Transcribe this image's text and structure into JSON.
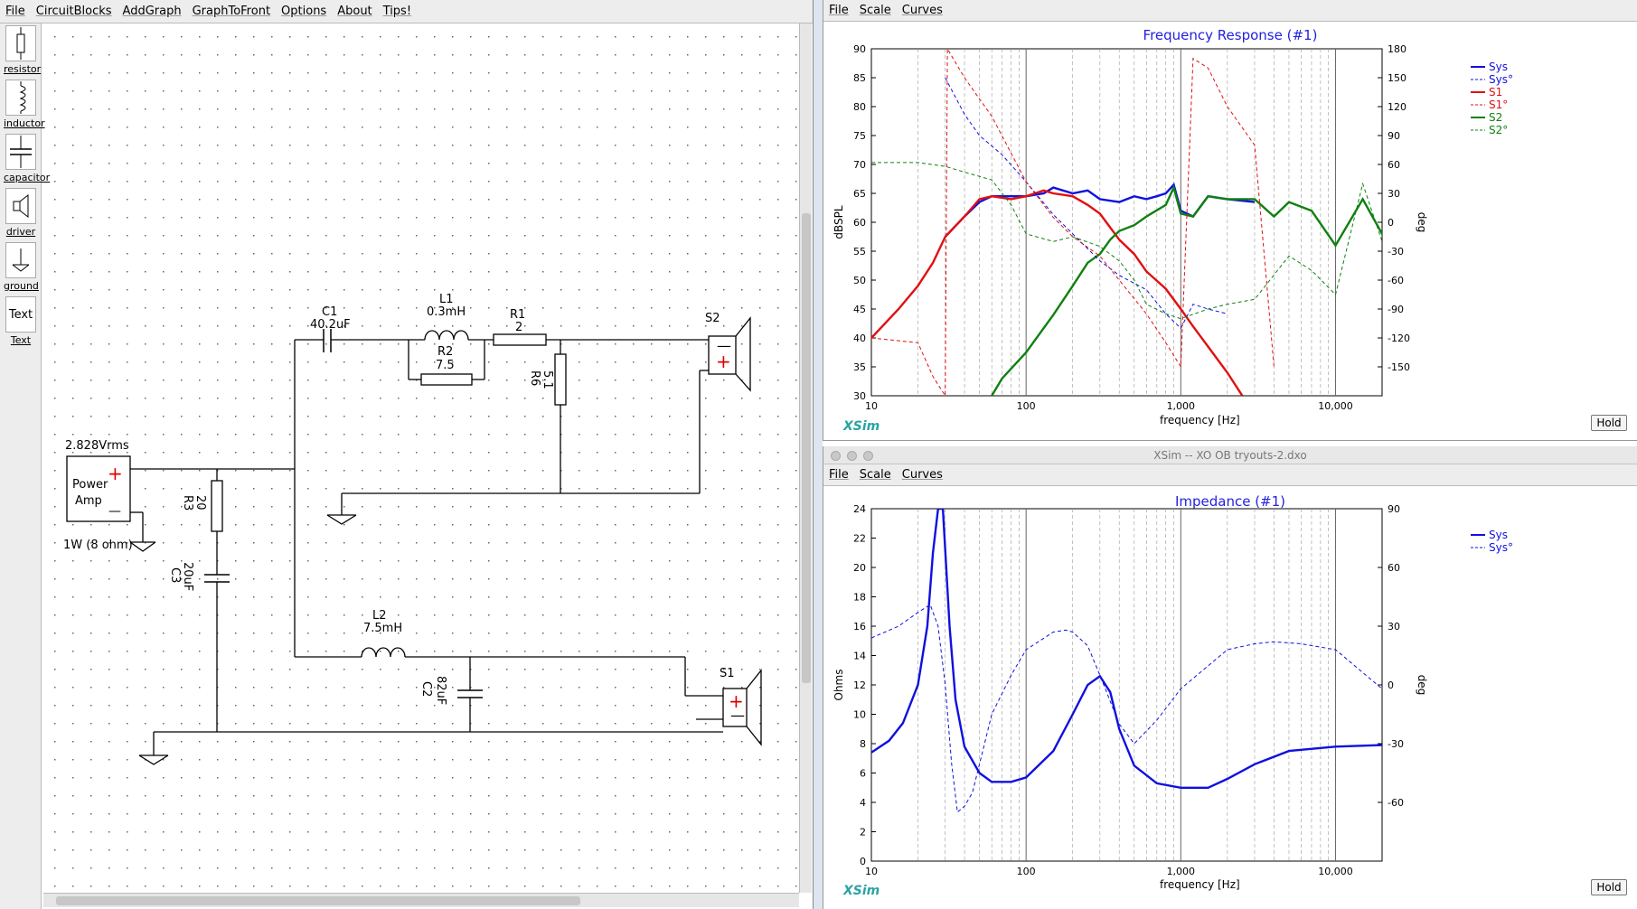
{
  "schematic": {
    "menu": [
      "File",
      "CircuitBlocks",
      "AddGraph",
      "GraphToFront",
      "Options",
      "About",
      "Tips!"
    ],
    "tools": [
      {
        "label": "resistor",
        "icon": "resistor-icon"
      },
      {
        "label": "inductor",
        "icon": "inductor-icon"
      },
      {
        "label": "capacitor",
        "icon": "capacitor-icon"
      },
      {
        "label": "driver",
        "icon": "driver-icon"
      },
      {
        "label": "ground",
        "icon": "ground-icon"
      },
      {
        "label": "Text",
        "icon": "text-icon",
        "glyph": "Text"
      }
    ],
    "amp": {
      "voltage": "2.828Vrms",
      "name": "Power Amp",
      "line1": "Power",
      "line2": "Amp",
      "load": "1W (8 ohm)",
      "plus": "+",
      "minus": "—"
    },
    "components": {
      "C1": {
        "name": "C1",
        "value": "40.2uF"
      },
      "L1": {
        "name": "L1",
        "value": "0.3mH"
      },
      "R1": {
        "name": "R1",
        "value": "2"
      },
      "R2": {
        "name": "R2",
        "value": "7.5"
      },
      "R6": {
        "name": "R6",
        "value": "5.1"
      },
      "R3": {
        "name": "R3",
        "value": "20"
      },
      "C3": {
        "name": "C3",
        "value": "20uF"
      },
      "L2": {
        "name": "L2",
        "value": "7.5mH"
      },
      "C2": {
        "name": "C2",
        "value": "82uF"
      },
      "S1": {
        "name": "S1"
      },
      "S2": {
        "name": "S2"
      }
    }
  },
  "freq_window": {
    "menu": [
      "File",
      "Scale",
      "Curves"
    ],
    "title": "Frequency Response (#1)",
    "brand": "XSim",
    "hold": "Hold",
    "xlabel": "frequency [Hz]",
    "ylabel": "dBSPL",
    "y2label": "deg",
    "legend": [
      {
        "name": "Sys",
        "color": "#1010e0",
        "dash": false
      },
      {
        "name": "Sys°",
        "color": "#1010e0",
        "dash": true
      },
      {
        "name": "S1",
        "color": "#e01010",
        "dash": false
      },
      {
        "name": "S1°",
        "color": "#e01010",
        "dash": true
      },
      {
        "name": "S2",
        "color": "#108010",
        "dash": false
      },
      {
        "name": "S2°",
        "color": "#108010",
        "dash": true
      }
    ]
  },
  "imp_window": {
    "window_title": "XSim -- XO OB tryouts-2.dxo",
    "menu": [
      "File",
      "Scale",
      "Curves"
    ],
    "title": "Impedance (#1)",
    "brand": "XSim",
    "hold": "Hold",
    "xlabel": "frequency [Hz]",
    "ylabel": "Ohms",
    "y2label": "deg",
    "legend": [
      {
        "name": "Sys",
        "color": "#1010e0",
        "dash": false
      },
      {
        "name": "Sys°",
        "color": "#1010e0",
        "dash": true
      }
    ]
  },
  "chart_data": [
    {
      "type": "line",
      "title": "Frequency Response (#1)",
      "xlabel": "frequency [Hz]",
      "ylabel": "dBSPL",
      "y2label": "deg",
      "xscale": "log",
      "xlim": [
        10,
        20000
      ],
      "ylim": [
        30,
        90
      ],
      "y2lim": [
        -180,
        180
      ],
      "xticks": [
        "10",
        "100",
        "1,000",
        "10,000"
      ],
      "yticks": [
        "30",
        "35",
        "40",
        "45",
        "50",
        "55",
        "60",
        "65",
        "70",
        "75",
        "80",
        "85",
        "90"
      ],
      "y2ticks": [
        "-150",
        "-120",
        "-90",
        "-60",
        "-30",
        "0",
        "30",
        "60",
        "90",
        "120",
        "150",
        "180"
      ],
      "legend_position": "top-right",
      "grid": true,
      "series": [
        {
          "name": "Sys",
          "axis": "left",
          "color": "#1010e0",
          "x": [
            30,
            40,
            50,
            60,
            80,
            100,
            130,
            150,
            200,
            250,
            300,
            400,
            500,
            600,
            700,
            800,
            900,
            1000,
            1200,
            1500,
            2000,
            3000
          ],
          "y": [
            57.5,
            61,
            63.5,
            64.5,
            64.5,
            64.5,
            65,
            66,
            65,
            65.5,
            64,
            63.5,
            64.5,
            64,
            64.5,
            65,
            66.5,
            62,
            61,
            64.5,
            64,
            63.5
          ]
        },
        {
          "name": "S1",
          "axis": "left",
          "color": "#e01010",
          "x": [
            10,
            15,
            20,
            25,
            30,
            40,
            50,
            60,
            80,
            100,
            130,
            150,
            200,
            250,
            300,
            400,
            500,
            600,
            800,
            1000,
            1200,
            1500,
            2000,
            2500
          ],
          "y": [
            40,
            45,
            49,
            53,
            57.5,
            61,
            64,
            64.5,
            64,
            64.5,
            65.5,
            65,
            64.5,
            63,
            61.5,
            57,
            54.5,
            51.5,
            48.5,
            45,
            42,
            38.5,
            34,
            30
          ]
        },
        {
          "name": "S2",
          "axis": "left",
          "color": "#108010",
          "x": [
            60,
            70,
            100,
            150,
            200,
            250,
            300,
            350,
            400,
            500,
            600,
            800,
            900,
            1000,
            1200,
            1500,
            2000,
            3000,
            4000,
            5000,
            7000,
            10000,
            15000,
            20000
          ],
          "y": [
            30,
            33,
            37.5,
            44,
            49,
            53,
            54.5,
            57,
            58.5,
            59.5,
            61,
            63,
            66,
            61.5,
            61,
            64.5,
            64,
            64,
            61,
            63.5,
            62,
            56,
            64,
            58
          ]
        },
        {
          "name": "Sys°",
          "axis": "right",
          "color": "#1010e0",
          "dash": true,
          "x": [
            30,
            40,
            50,
            70,
            100,
            150,
            200,
            300,
            400,
            600,
            800,
            1000,
            1200,
            1500,
            2000
          ],
          "y": [
            150,
            112,
            90,
            70,
            42,
            8,
            -12,
            -40,
            -55,
            -70,
            -95,
            -110,
            -85,
            -90,
            -95
          ]
        },
        {
          "name": "S1°",
          "axis": "right",
          "color": "#e01010",
          "dash": true,
          "x": [
            10,
            20,
            25,
            30,
            31,
            40,
            60,
            100,
            150,
            200,
            300,
            400,
            600,
            800,
            1000,
            1200,
            1500,
            2000,
            3000,
            4000
          ],
          "y": [
            -120,
            -125,
            -160,
            -180,
            180,
            150,
            110,
            42,
            5,
            -15,
            -35,
            -60,
            -95,
            -125,
            -150,
            170,
            160,
            120,
            80,
            -150
          ]
        },
        {
          "name": "S2°",
          "axis": "right",
          "color": "#108010",
          "dash": true,
          "x": [
            10,
            20,
            30,
            40,
            60,
            80,
            100,
            150,
            200,
            300,
            400,
            500,
            600,
            800,
            1000,
            1500,
            2000,
            3000,
            5000,
            7000,
            10000,
            15000,
            20000
          ],
          "y": [
            62,
            62,
            58,
            52,
            44,
            18,
            -12,
            -20,
            -15,
            -25,
            -40,
            -60,
            -85,
            -95,
            -100,
            -90,
            -85,
            -80,
            -35,
            -50,
            -75,
            40,
            -20
          ]
        }
      ]
    },
    {
      "type": "line",
      "title": "Impedance (#1)",
      "xlabel": "frequency [Hz]",
      "ylabel": "Ohms",
      "y2label": "deg",
      "xscale": "log",
      "xlim": [
        10,
        20000
      ],
      "ylim": [
        0,
        24
      ],
      "y2lim": [
        -90,
        90
      ],
      "xticks": [
        "10",
        "100",
        "1,000",
        "10,000"
      ],
      "yticks": [
        "0",
        "2",
        "4",
        "6",
        "8",
        "10",
        "12",
        "14",
        "16",
        "18",
        "20",
        "22",
        "24"
      ],
      "y2ticks": [
        "-60",
        "-30",
        "0",
        "30",
        "60",
        "90"
      ],
      "legend_position": "top-right",
      "grid": true,
      "series": [
        {
          "name": "Sys",
          "axis": "left",
          "color": "#1010e0",
          "x": [
            10,
            13,
            16,
            20,
            23,
            25,
            27,
            29,
            32,
            35,
            40,
            50,
            60,
            80,
            100,
            150,
            200,
            250,
            300,
            350,
            400,
            500,
            700,
            1000,
            1500,
            2000,
            3000,
            5000,
            10000,
            20000
          ],
          "y": [
            7.4,
            8.2,
            9.4,
            12,
            16,
            21,
            24,
            24,
            16,
            11,
            7.8,
            6,
            5.4,
            5.4,
            5.7,
            7.5,
            10,
            12,
            12.6,
            11.5,
            9,
            6.5,
            5.3,
            5,
            5,
            5.6,
            6.6,
            7.5,
            7.8,
            7.9
          ]
        },
        {
          "name": "Sys°",
          "axis": "right",
          "color": "#1010e0",
          "dash": true,
          "x": [
            10,
            15,
            20,
            24,
            27,
            30,
            33,
            36,
            40,
            45,
            60,
            80,
            100,
            150,
            180,
            200,
            250,
            300,
            400,
            500,
            700,
            1000,
            2000,
            3000,
            4000,
            6000,
            10000,
            20000
          ],
          "y": [
            24,
            30,
            37,
            41,
            30,
            0,
            -40,
            -65,
            -62,
            -55,
            -15,
            5,
            18,
            27,
            28,
            27,
            20,
            5,
            -20,
            -30,
            -18,
            -2,
            18,
            21,
            22,
            21,
            18,
            -2
          ]
        }
      ]
    }
  ]
}
